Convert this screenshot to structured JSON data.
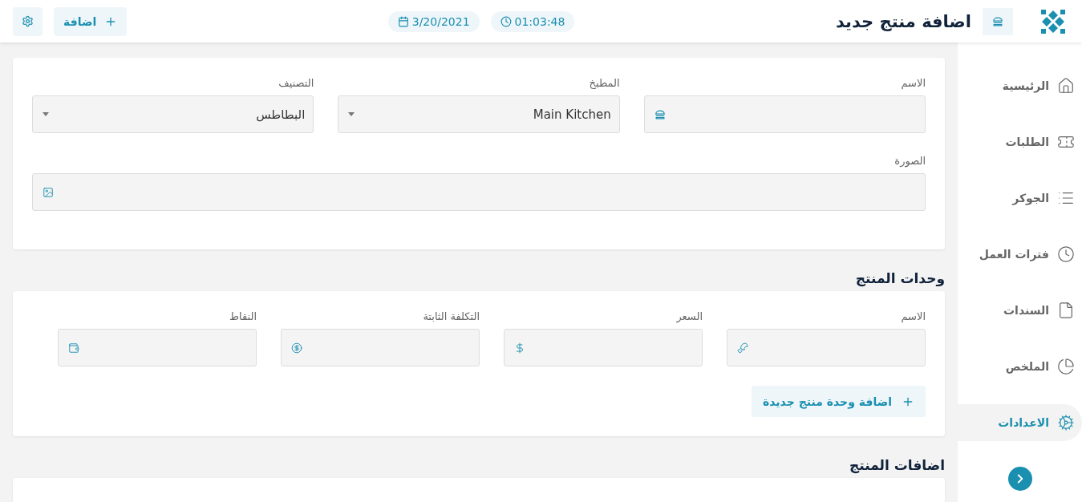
{
  "header": {
    "title": "اضافة منتج جديد",
    "time": "01:03:48",
    "date": "3/20/2021",
    "add_button": "اضافة"
  },
  "sidebar": {
    "items": [
      {
        "label": "الرئيسية",
        "kind": "home",
        "selected": false
      },
      {
        "label": "الطلبات",
        "kind": "ticket",
        "selected": false
      },
      {
        "label": "الجوكر",
        "kind": "list",
        "selected": false
      },
      {
        "label": "فترات العمل",
        "kind": "clock",
        "selected": false
      },
      {
        "label": "السندات",
        "kind": "file",
        "selected": false
      },
      {
        "label": "الملخص",
        "kind": "pie",
        "selected": false
      },
      {
        "label": "الاعدادات",
        "kind": "gears",
        "selected": true
      }
    ]
  },
  "product": {
    "fields": [
      {
        "label": "الاسم",
        "kind": "input"
      },
      {
        "label": "المطبخ",
        "kind": "select",
        "value": "Main Kitchen"
      },
      {
        "label": "التصنيف",
        "kind": "select",
        "value": "البطاطس"
      }
    ],
    "image_field": {
      "label": "الصورة"
    }
  },
  "units": {
    "heading": "وحدات المنتج",
    "fields": [
      {
        "label": "الاسم",
        "kind": "drumstick"
      },
      {
        "label": "السعر",
        "kind": "dollar"
      },
      {
        "label": "التكلفة الثابتة",
        "kind": "coin"
      },
      {
        "label": "النقاط",
        "kind": "wallet"
      }
    ],
    "add_button": "اضافة وحدة منتج جديدة"
  },
  "extras": {
    "heading": "اضافات المنتج"
  }
}
